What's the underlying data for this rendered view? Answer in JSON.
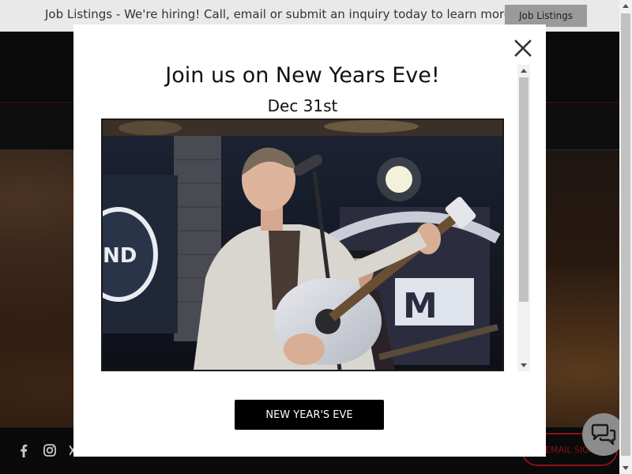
{
  "topbar": {
    "message": "Job Listings - We're hiring! Call, email or submit an inquiry today to learn more!",
    "button_label": "Job Listings"
  },
  "background_page": {
    "social_icons": [
      "facebook-icon",
      "instagram-icon",
      "twitter-icon"
    ],
    "email_button_label": "EMAIL SIGN",
    "chat_icon": "chat-bubbles-icon"
  },
  "modal": {
    "title": "Join us on New Years Eve!",
    "subtitle": "Dec 31st",
    "close_icon": "close-icon",
    "image_alt": "Singer with acoustic guitar performing at a microphone on stage",
    "cta_label": "NEW YEAR'S EVE"
  },
  "colors": {
    "topbar_bg": "#e9e9e9",
    "topbar_button_bg": "#9a9a9a",
    "modal_bg": "#ffffff",
    "cta_bg": "#000000",
    "cta_text": "#ffffff",
    "accent_red": "#8a1212"
  }
}
